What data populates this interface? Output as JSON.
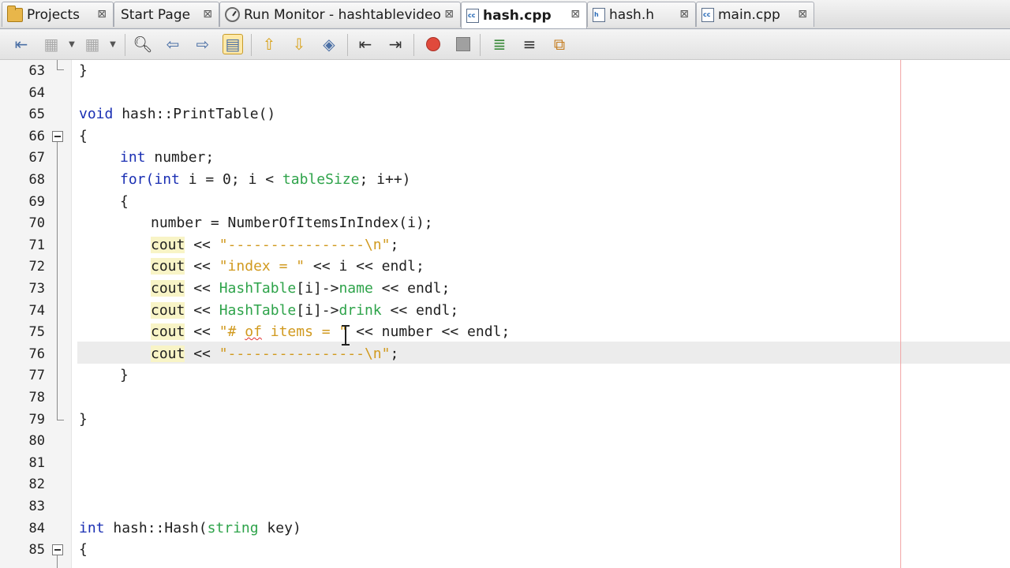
{
  "tabs": [
    {
      "label": "Projects",
      "icon": "projects-folder-icon",
      "active": false
    },
    {
      "label": "Start Page",
      "icon": "",
      "active": false
    },
    {
      "label": "Run Monitor - hashtablevideo",
      "icon": "run-monitor-icon",
      "active": false
    },
    {
      "label": "hash.cpp",
      "icon": "cpp-file-icon",
      "active": true
    },
    {
      "label": "hash.h",
      "icon": "header-file-icon",
      "active": false
    },
    {
      "label": "main.cpp",
      "icon": "cpp-file-icon",
      "active": false
    }
  ],
  "tab_close_glyph": "⊠",
  "toolbar": {
    "icons": [
      "back-icon",
      "history-icon",
      "forward-icon",
      "find-icon",
      "find-previous-icon",
      "find-next-icon",
      "toggle-highlight-icon",
      "previous-bookmark-icon",
      "next-bookmark-icon",
      "toggle-bookmark-icon",
      "shift-left-icon",
      "shift-right-icon",
      "start-macro-icon",
      "stop-macro-icon",
      "comment-icon",
      "uncomment-icon",
      "diff-icon"
    ]
  },
  "editor": {
    "lines": [
      {
        "n": "63",
        "text": "}"
      },
      {
        "n": "64",
        "text": ""
      },
      {
        "n": "65",
        "kw": "void",
        "rest": " hash::PrintTable()"
      },
      {
        "n": "66",
        "text": "{"
      },
      {
        "n": "67",
        "kw": "int",
        "rest": " number;"
      },
      {
        "n": "68",
        "pre": "for(",
        "kw": "int",
        "mid": " i = 0; i < ",
        "ty": "tableSize",
        "post": "; i++)"
      },
      {
        "n": "69",
        "text": "{"
      },
      {
        "n": "70",
        "text": "number = NumberOfItemsInIndex(i);"
      },
      {
        "n": "71",
        "cout": "cout",
        "op": " << ",
        "str": "\"----------------\\n\"",
        "post": ";"
      },
      {
        "n": "72",
        "cout": "cout",
        "op": " << ",
        "str": "\"index = \"",
        "post": " << i << endl;"
      },
      {
        "n": "73",
        "cout": "cout",
        "op": " << ",
        "ty": "HashTable",
        "mid": "[i]->",
        "mem": "name",
        "post": " << endl;"
      },
      {
        "n": "74",
        "cout": "cout",
        "op": " << ",
        "ty": "HashTable",
        "mid": "[i]->",
        "mem": "drink",
        "post": " << endl;"
      },
      {
        "n": "75",
        "cout": "cout",
        "op": " << ",
        "str_a": "\"# ",
        "str_sq": "of",
        "str_b": " items = \"",
        "post": " << number << endl;"
      },
      {
        "n": "76",
        "cout": "cout",
        "op": " << ",
        "str": "\"----------------\\n\"",
        "post": ";"
      },
      {
        "n": "77",
        "text": "}"
      },
      {
        "n": "78",
        "text": ""
      },
      {
        "n": "79",
        "text": "}"
      },
      {
        "n": "80",
        "text": ""
      },
      {
        "n": "81",
        "text": ""
      },
      {
        "n": "82",
        "text": ""
      },
      {
        "n": "83",
        "text": ""
      },
      {
        "n": "84",
        "kw": "int",
        "mid": " hash::Hash(",
        "ty": "string",
        "post": " key)"
      },
      {
        "n": "85",
        "text": "{"
      }
    ]
  },
  "colors": {
    "keyword": "#1a2fb3",
    "string": "#d19a1f",
    "type": "#2ea34a",
    "cout_highlight": "#f8f4c6",
    "current_line": "#ececec",
    "margin_line": "#f2a6a6"
  }
}
